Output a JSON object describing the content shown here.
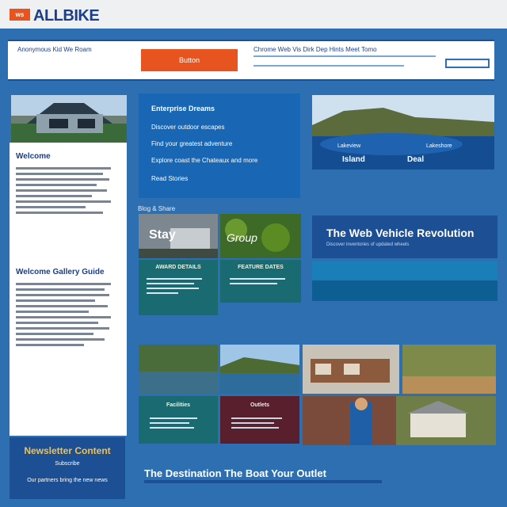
{
  "header": {
    "logo_badge": "ws",
    "logo_text": "ALLBIKE",
    "left_text": "Anonymous Kid We Roam",
    "right_text": "Chrome Web Vis Dirk Dep Hints Meet Tomo",
    "button_label": "Button",
    "search_placeholder": ""
  },
  "hero": {
    "card_title": "Enterprise Dreams",
    "card_line1": "Discover outdoor escapes",
    "card_line2": "Find your greatest adventure",
    "card_line3": "Explore coast the Chateaux and more",
    "card_footer": "Read Stories",
    "lake_caption1": "Lakeview",
    "lake_caption2": "Island",
    "lake_caption3": "Lakeshore",
    "lake_caption4": "Deal"
  },
  "sidebar": {
    "title1": "Welcome",
    "title2": "Welcome Gallery Guide",
    "footer_title": "Newsletter Content",
    "footer_sub": "Subscribe",
    "footer_small": "Our partners bring the new news"
  },
  "tiles": {
    "section_label": "Blog & Share",
    "t1": "Stay",
    "t2": "Group",
    "teal1": "AWARD DETAILS",
    "teal2": "FEATURE DATES",
    "teal3": "Facilities",
    "maroon": "Outlets"
  },
  "feature": {
    "title": "The Web Vehicle Revolution",
    "sub": "Discover inventories of updated wheels"
  },
  "bottom": {
    "title": "The Destination The Boat Your Outlet"
  },
  "colors": {
    "brand": "#1b3f8a",
    "accent": "#e8541f",
    "blue": "#1866b4",
    "teal": "#1a6b71",
    "maroon": "#5a1f2c"
  }
}
